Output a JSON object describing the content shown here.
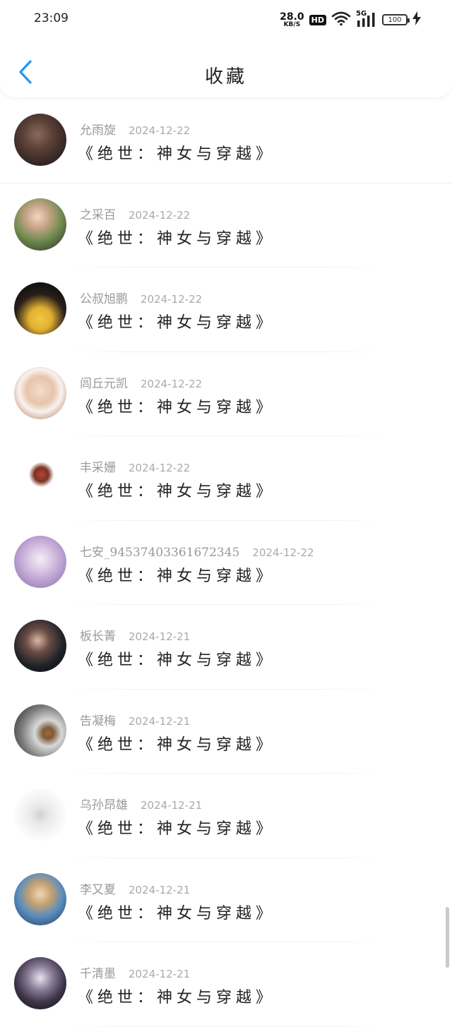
{
  "status_bar": {
    "time": "23:09",
    "net_speed": "28.0",
    "net_speed_unit": "KB/S",
    "hd_badge": "HD",
    "network_type": "5G",
    "battery": "100"
  },
  "header": {
    "back_icon": "chevron-left-icon",
    "title": "收藏",
    "accent_color": "#2196f3"
  },
  "favorites": [
    {
      "user": "允雨旋",
      "date": "2024-12-22",
      "book": "《绝世：神女与穿越》",
      "avatar": "dark-portrait"
    },
    {
      "user": "之采百",
      "date": "2024-12-22",
      "book": "《绝世：神女与穿越》",
      "avatar": "outdoor-portrait"
    },
    {
      "user": "公叔旭鹏",
      "date": "2024-12-22",
      "book": "《绝世：神女与穿越》",
      "avatar": "basketball-player"
    },
    {
      "user": "闾丘元凯",
      "date": "2024-12-22",
      "book": "《绝世：神女与穿越》",
      "avatar": "young-man"
    },
    {
      "user": "丰采姗",
      "date": "2024-12-22",
      "book": "《绝世：神女与穿越》",
      "avatar": "cartoon-character"
    },
    {
      "user": "七安_94537403361672345",
      "date": "2024-12-22",
      "book": "《绝世：神女与穿越》",
      "avatar": "anime-girl"
    },
    {
      "user": "板长菁",
      "date": "2024-12-21",
      "book": "《绝世：神女与穿越》",
      "avatar": "dark-portrait-2"
    },
    {
      "user": "告凝梅",
      "date": "2024-12-21",
      "book": "《绝世：神女与穿越》",
      "avatar": "box-figure"
    },
    {
      "user": "乌孙昂雄",
      "date": "2024-12-21",
      "book": "《绝世：神女与穿越》",
      "avatar": "light-abstract"
    },
    {
      "user": "李又夏",
      "date": "2024-12-21",
      "book": "《绝世：神女与穿越》",
      "avatar": "anime-boy"
    },
    {
      "user": "千清墨",
      "date": "2024-12-21",
      "book": "《绝世：神女与穿越》",
      "avatar": "anime-warrior"
    }
  ]
}
